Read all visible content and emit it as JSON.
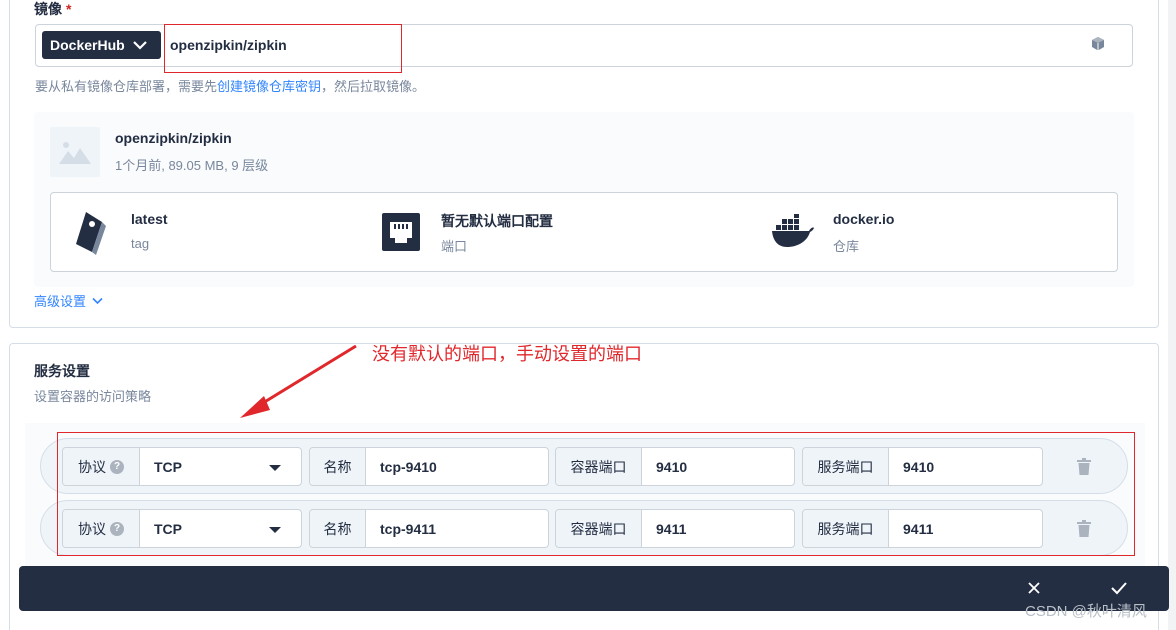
{
  "image_field": {
    "label": "镜像",
    "required_mark": "*",
    "registry": "DockerHub",
    "value": "openzipkin/zipkin"
  },
  "hint": {
    "prefix": "要从私有镜像仓库部署，需要先",
    "link": "创建镜像仓库密钥",
    "suffix": "，然后拉取镜像。"
  },
  "image_info": {
    "name": "openzipkin/zipkin",
    "meta": "1个月前, 89.05 MB, 9 层级",
    "tag_value": "latest",
    "tag_label": "tag",
    "port_value": "暂无默认端口配置",
    "port_label": "端口",
    "registry_value": "docker.io",
    "registry_label": "仓库"
  },
  "advanced": {
    "label": "高级设置"
  },
  "annotation": "没有默认的端口，手动设置的端口",
  "service_settings": {
    "title": "服务设置",
    "subtitle": "设置容器的访问策略"
  },
  "ports": [
    {
      "protocol_label": "协议",
      "protocol": "TCP",
      "name_label": "名称",
      "name": "tcp-9410",
      "container_port_label": "容器端口",
      "container_port": "9410",
      "service_port_label": "服务端口",
      "service_port": "9410"
    },
    {
      "protocol_label": "协议",
      "protocol": "TCP",
      "name_label": "名称",
      "name": "tcp-9411",
      "container_port_label": "容器端口",
      "container_port": "9411",
      "service_port_label": "服务端口",
      "service_port": "9411"
    }
  ],
  "watermark": "CSDN @秋叶清风",
  "icons": {
    "registry_chevron": "chevron-down-icon",
    "cube": "cube-icon",
    "image_placeholder": "image-icon",
    "tag": "tag-icon",
    "port": "ethernet-port-icon",
    "docker": "docker-whale-icon",
    "advanced_chevron": "chevron-down-icon",
    "help": "question-icon",
    "delete": "trash-icon",
    "close": "close-icon",
    "confirm": "check-icon"
  },
  "colors": {
    "dark": "#242e42",
    "link": "#3385ff",
    "annotation": "#e0282c",
    "muted": "#79879c"
  }
}
